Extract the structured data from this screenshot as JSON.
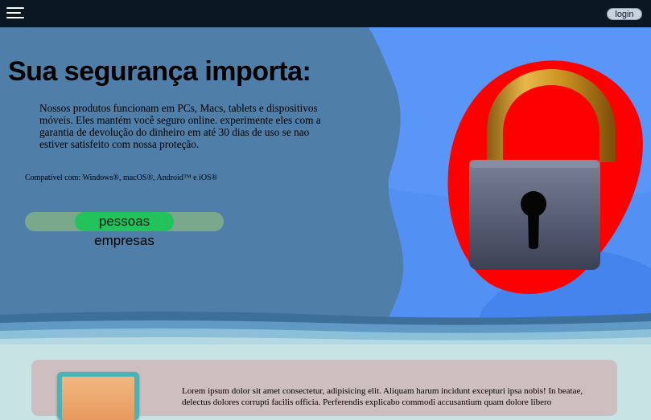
{
  "header": {
    "menu_icon": "hamburger-menu-icon",
    "login_label": "login"
  },
  "hero": {
    "title": "Sua segurança importa:",
    "description": "Nossos produtos funcionam em PCs, Macs, tablets e dispositivos móveis. Eles mantém você seguro online. experimente eles com a garantia de devolução do dinheiro em até 30 dias de uso se nao estiver satisfeito com nossa proteção.",
    "compat": "Compatível com: Windows®, macOS®, Android™ e iOS®",
    "toggle": {
      "selected": "pessoas",
      "options": [
        "pessoas",
        "empresas"
      ]
    },
    "illustration": "padlock-illustration"
  },
  "section": {
    "text": "Lorem ipsum dolor sit amet consectetur, adipisicing elit. Aliquam harum incidunt excepturi ipsa nobis! In beatae, delectus dolores corrupti facilis officia. Perferendis explicabo commodi accusantium quam dolore libero"
  },
  "colors": {
    "topbar": "#0b1822",
    "hero_left": "#4f7fa9",
    "hero_right": "#5a96f7",
    "blob": "#ff0000",
    "toggle_active": "#22c35a",
    "page_bottom": "#c7e3e3",
    "card": "#cdbfbf"
  }
}
